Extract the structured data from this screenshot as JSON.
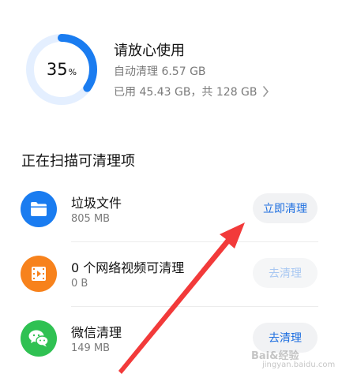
{
  "storage": {
    "percent": "35",
    "percent_unit": "%",
    "percent_value": 0.35,
    "title": "请放心使用",
    "auto_clean": "自动清理 6.57 GB",
    "usage": "已用 45.43 GB，共 128 GB"
  },
  "section_title": "正在扫描可清理项",
  "items": [
    {
      "title": "垃圾文件",
      "size": "805 MB",
      "button": "立即清理",
      "icon": "folder-icon",
      "icon_color": "#1a7cf0"
    },
    {
      "title": "0 个网络视频可清理",
      "size": "0 B",
      "button": "去清理",
      "icon": "video-icon",
      "icon_color": "#f7821c"
    },
    {
      "title": "微信清理",
      "size": "149 MB",
      "button": "去清理",
      "icon": "wechat-icon",
      "icon_color": "#2fc152"
    }
  ],
  "colors": {
    "accent": "#1e6fe0",
    "ring": "#1a7cf0",
    "ring_track": "#e4efff",
    "arrow": "#f23a3a"
  },
  "watermark": {
    "brand": "Bai&经验",
    "site": "jingyan.baidu.com"
  }
}
